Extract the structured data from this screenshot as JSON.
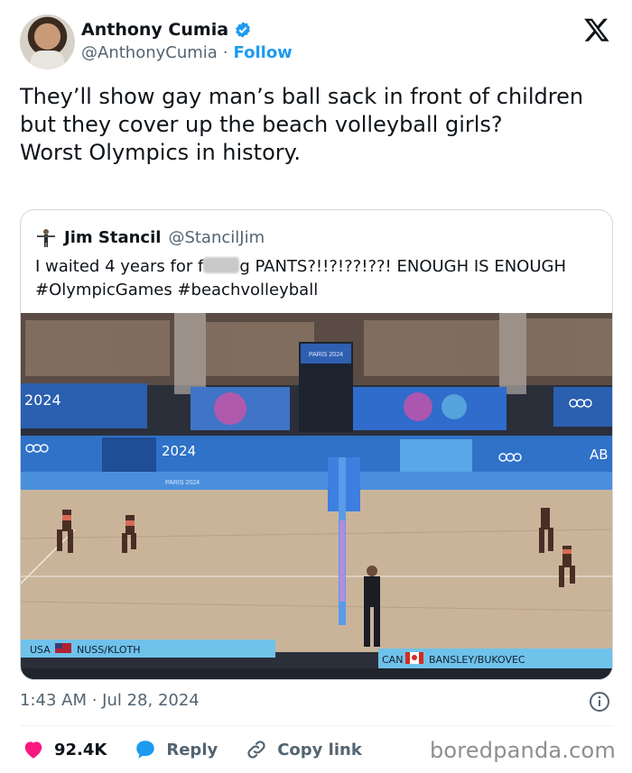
{
  "author": {
    "display_name": "Anthony Cumia",
    "handle": "@AnthonyCumia",
    "separator": "·",
    "follow_label": "Follow"
  },
  "tweet": {
    "text": "They’ll show gay man’s ball sack in front of children but they cover up the beach volleyball girls?\nWorst Olympics in history."
  },
  "quoted_tweet": {
    "display_name": "Jim Stancil",
    "handle": "@StancilJim",
    "text_before_censor": "I waited 4 years for f",
    "text_after_censor": "g PANTS?!!?!??!??! ENOUGH IS ENOUGH #OlympicGames #beachvolleyball",
    "image": {
      "banner_left": "2024",
      "banner_mid": "2024",
      "banner_right": "AB",
      "screen_text": "PARIS 2024",
      "ad_small": "PARIS 2024",
      "scoreboard_left_country": "USA",
      "scoreboard_left_team": "NUSS/KLOTH",
      "scoreboard_right_country": "CAN",
      "scoreboard_right_team": "BANSLEY/BUKOVEC"
    }
  },
  "meta": {
    "timestamp": "1:43 AM · Jul 28, 2024"
  },
  "actions": {
    "like_count": "92.4K",
    "reply_label": "Reply",
    "copy_link_label": "Copy link"
  },
  "watermark": "boredpanda.com",
  "colors": {
    "accent_blue": "#1d9bf0",
    "like_red": "#f91880",
    "muted_text": "#536471"
  }
}
